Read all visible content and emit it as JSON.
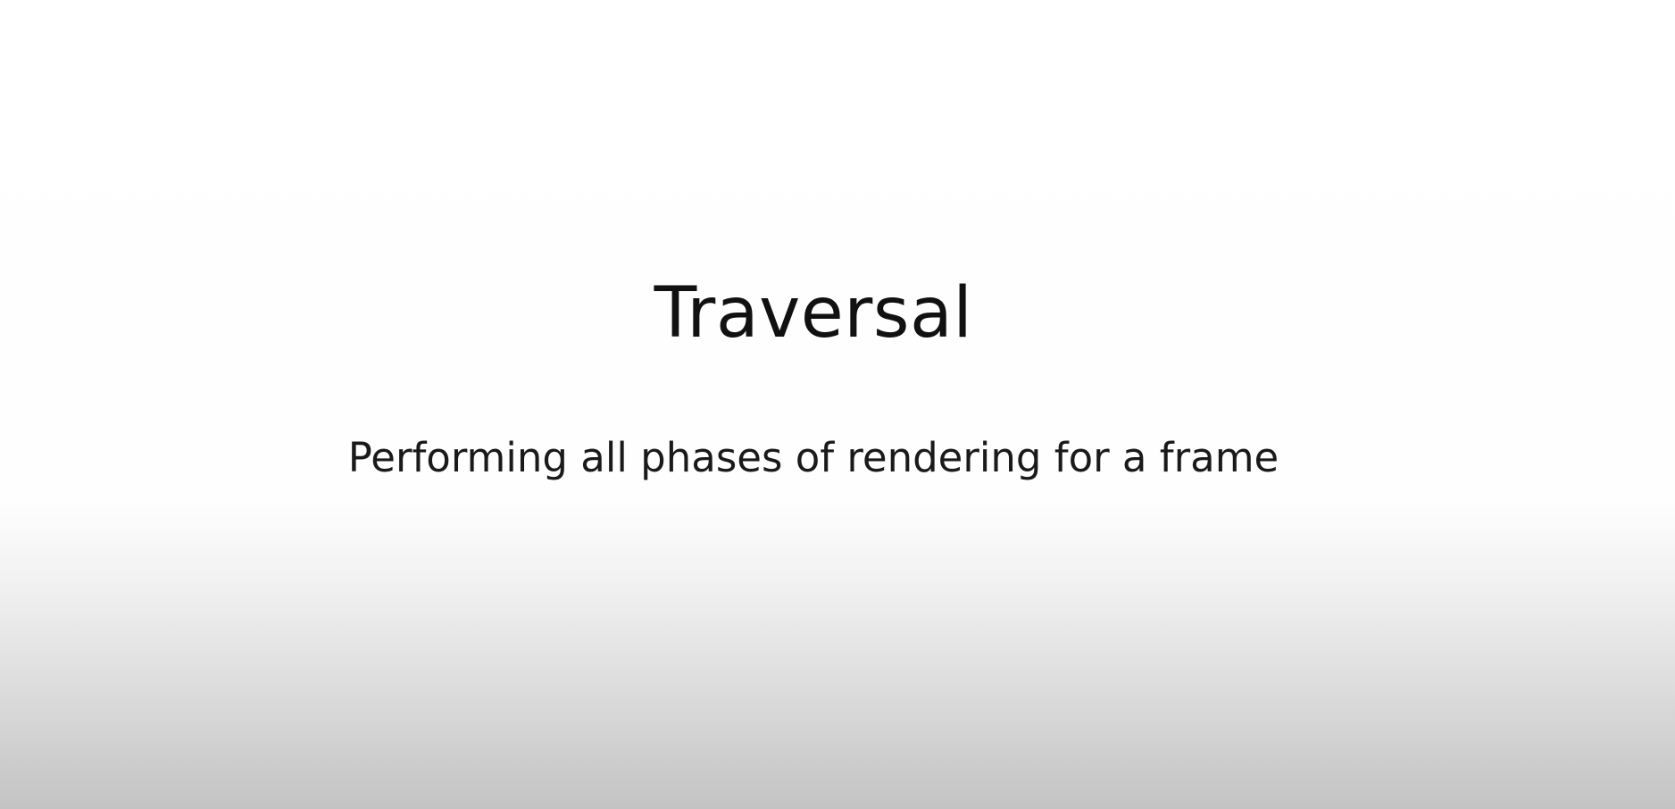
{
  "slide": {
    "title": "Traversal",
    "subtitle": "Performing all phases of rendering for a frame"
  },
  "colors": {
    "text": "#111111",
    "background_top": "#ffffff",
    "background_bottom": "#c3c3c3"
  }
}
